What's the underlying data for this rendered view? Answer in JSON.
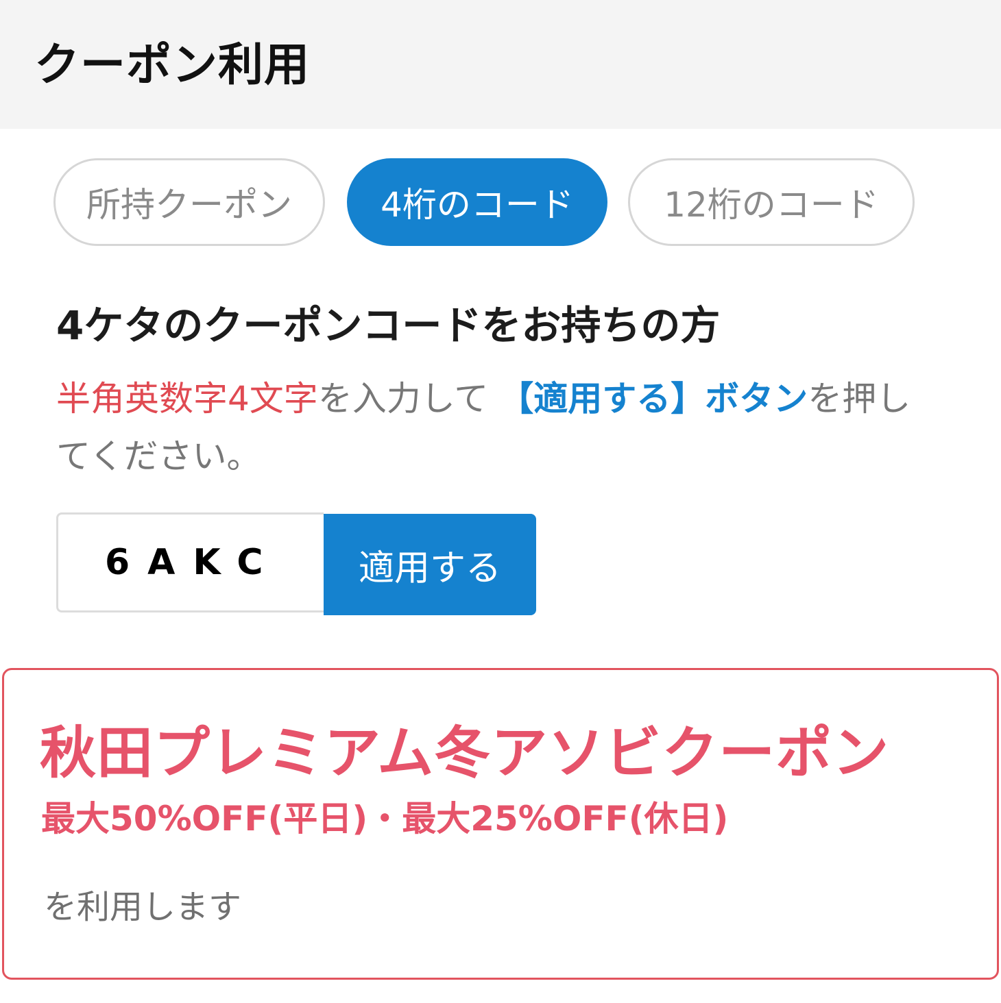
{
  "header": {
    "title": "クーポン利用"
  },
  "tabs": [
    {
      "label": "所持クーポン",
      "active": false
    },
    {
      "label": "4桁のコード",
      "active": true
    },
    {
      "label": "12桁のコード",
      "active": false
    }
  ],
  "section": {
    "heading": "4ケタのクーポンコードをお持ちの方",
    "instructions": {
      "part1": "半角英数字4文字",
      "part2": "を入力して ",
      "part3": "【適用する】ボタン",
      "part4": "を押してください。"
    }
  },
  "code_form": {
    "value": "6AKC",
    "apply_label": "適用する"
  },
  "coupon": {
    "name": "秋田プレミアム冬アソビクーポン",
    "discount": "最大50%OFF(平日)・最大25%OFF(休日)",
    "note": "を利用します"
  },
  "colors": {
    "accent_blue": "#1582cf",
    "accent_red": "#e6536a",
    "header_bg": "#f4f4f4"
  }
}
